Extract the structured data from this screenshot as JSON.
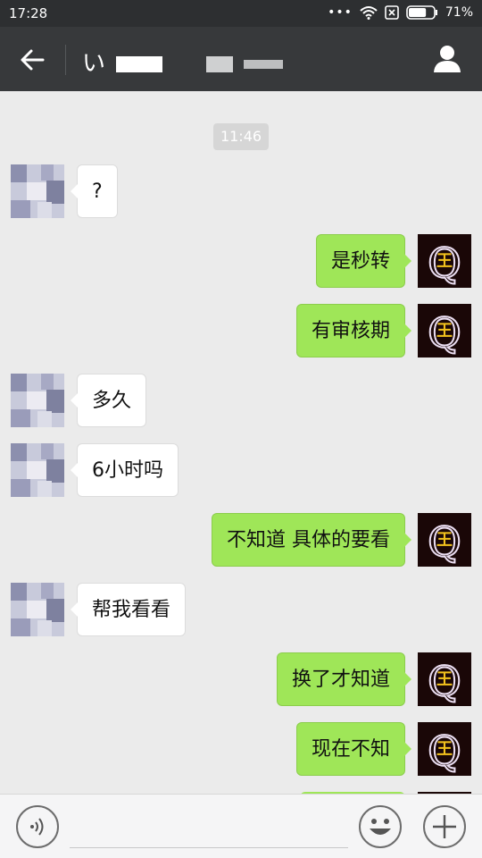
{
  "status_bar": {
    "time": "17:28",
    "dots": "•••",
    "battery_percent": "71%",
    "battery_level": 0.71
  },
  "nav": {
    "title_visible_char": "い",
    "back_icon": "arrow-left-icon",
    "profile_icon": "person-icon"
  },
  "chat": {
    "timestamp": "11:46",
    "messages": [
      {
        "direction": "in",
        "text": "?"
      },
      {
        "direction": "out",
        "text": "是秒转"
      },
      {
        "direction": "out",
        "text": "有审核期"
      },
      {
        "direction": "in",
        "text": "多久"
      },
      {
        "direction": "in",
        "text": "6小时吗"
      },
      {
        "direction": "out",
        "text": "不知道 具体的要看"
      },
      {
        "direction": "in",
        "text": "帮我看看"
      },
      {
        "direction": "out",
        "text": "换了才知道"
      },
      {
        "direction": "out",
        "text": "现在不知"
      }
    ],
    "self_avatar_letter": "Q",
    "self_avatar_glyph": "王"
  },
  "input_bar": {
    "input_value": "",
    "voice_icon": "voice-icon",
    "emoji_icon": "emoji-icon",
    "plus_icon": "plus-icon"
  },
  "colors": {
    "status_bar": "#2d2f31",
    "nav_bar": "#37393b",
    "chat_background": "#ebebeb",
    "outgoing_bubble": "#9fe658",
    "incoming_bubble": "#ffffff"
  }
}
